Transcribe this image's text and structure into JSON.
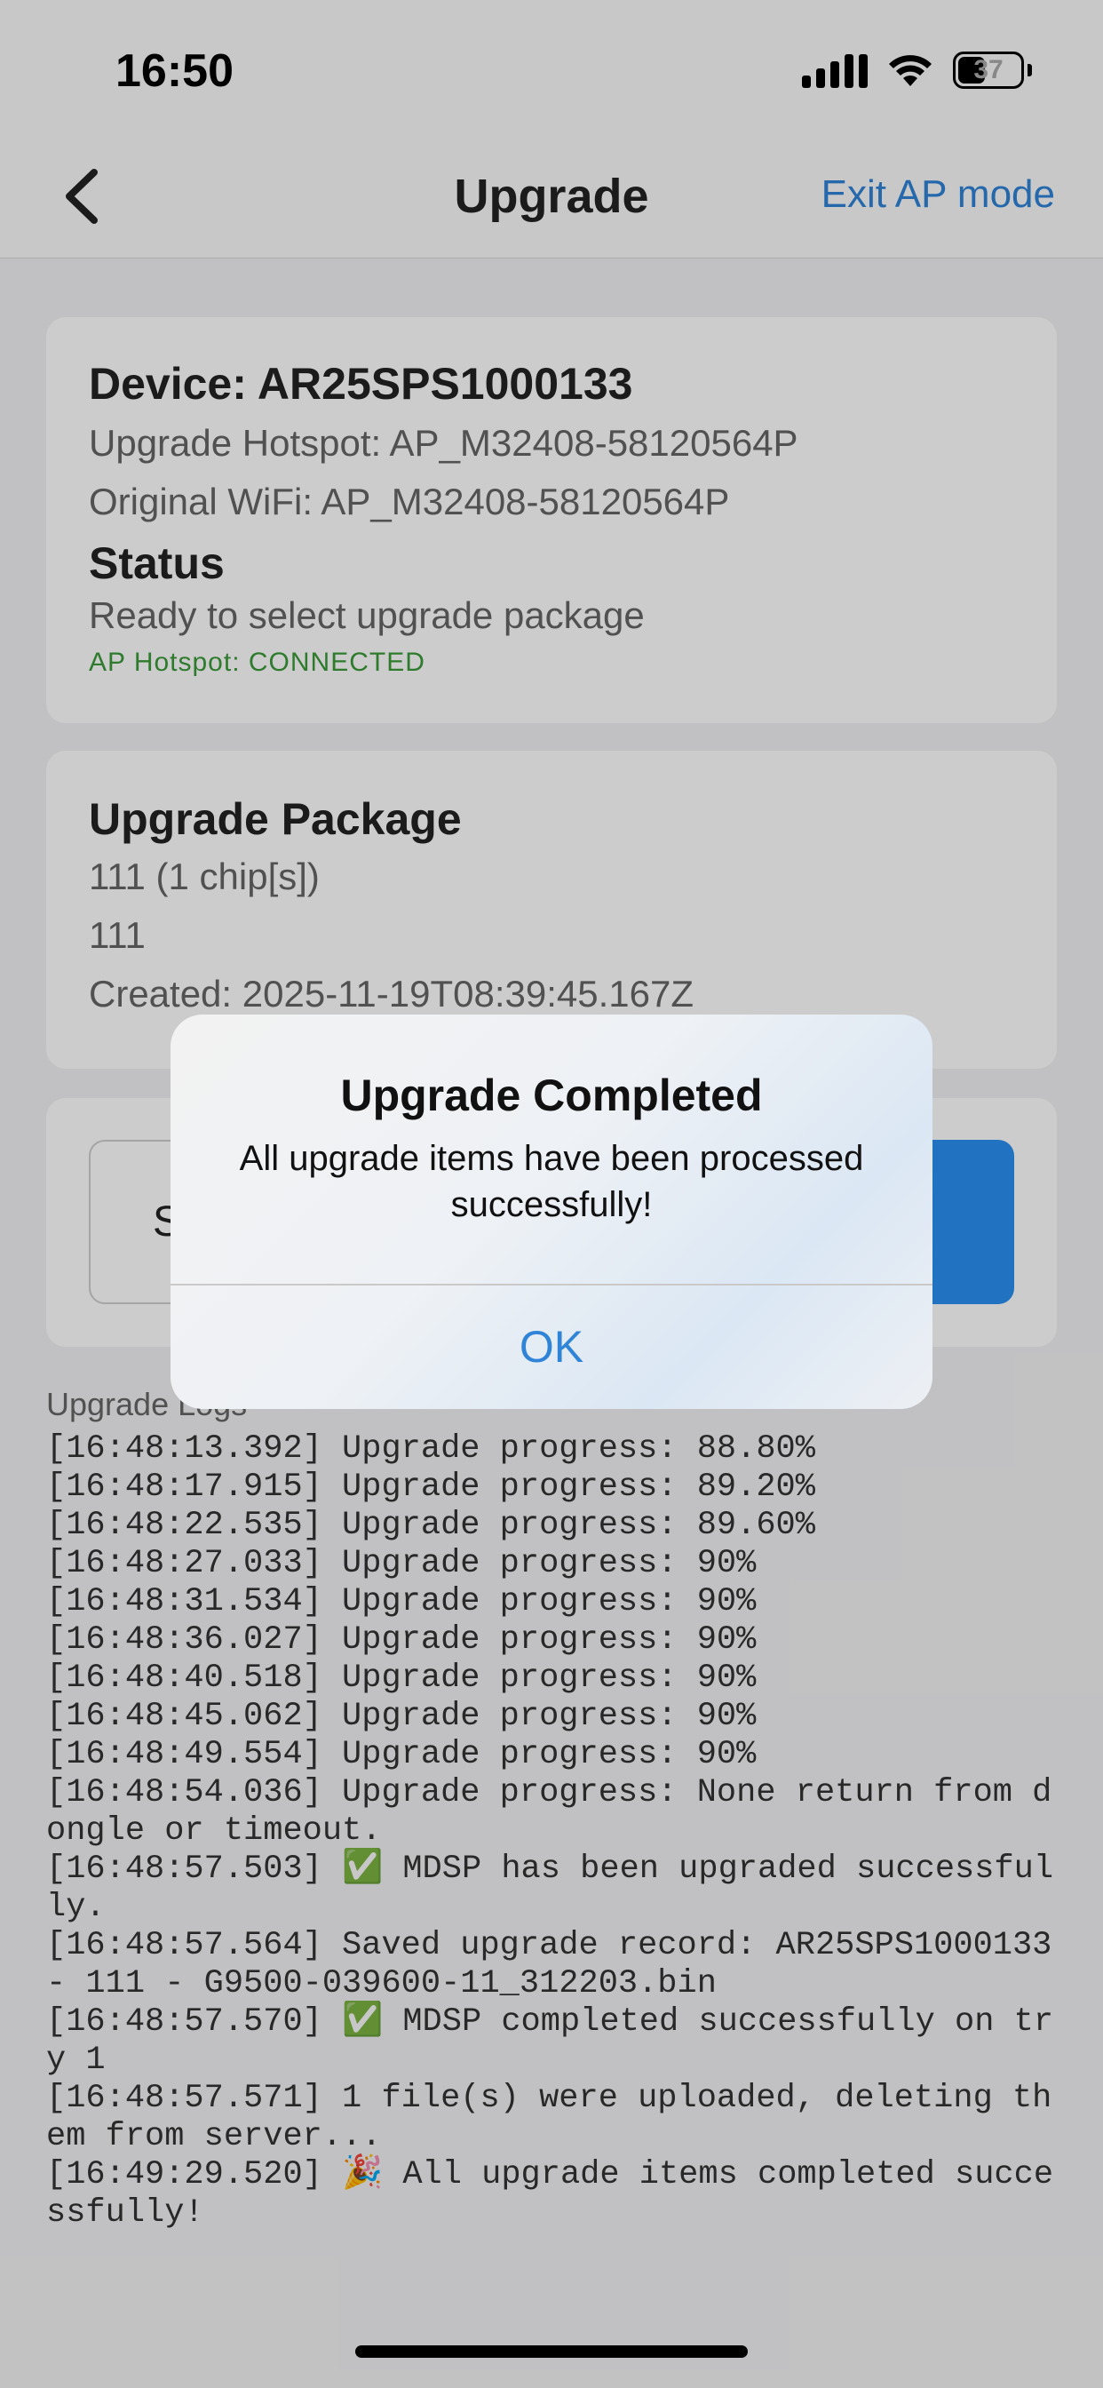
{
  "status_bar": {
    "time": "16:50",
    "battery_level": "37",
    "icons": [
      "signal-icon",
      "wifi-icon",
      "battery-icon"
    ]
  },
  "nav": {
    "title": "Upgrade",
    "back_icon": "chevron-left-icon",
    "exit_label": "Exit AP mode"
  },
  "device": {
    "title": "Device: AR25SPS1000133",
    "hotspot": "Upgrade Hotspot: AP_M32408-58120564P",
    "original_wifi": "Original WiFi: AP_M32408-58120564P",
    "status_heading": "Status",
    "status_text": "Ready to select upgrade package",
    "hotspot_status": "AP Hotspot: CONNECTED"
  },
  "package": {
    "heading": "Upgrade Package",
    "name": "111 (1 chip[s])",
    "version": "111",
    "created": "Created: 2025-11-19T08:39:45.167Z"
  },
  "actions": {
    "left_label_partial": "S"
  },
  "logs": {
    "label": "Upgrade Logs",
    "lines": [
      "[16:48:13.392] Upgrade progress: 88.80%",
      "[16:48:17.915] Upgrade progress: 89.20%",
      "[16:48:22.535] Upgrade progress: 89.60%",
      "[16:48:27.033] Upgrade progress: 90%",
      "[16:48:31.534] Upgrade progress: 90%",
      "[16:48:36.027] Upgrade progress: 90%",
      "[16:48:40.518] Upgrade progress: 90%",
      "[16:48:45.062] Upgrade progress: 90%",
      "[16:48:49.554] Upgrade progress: 90%",
      "[16:48:54.036] Upgrade progress: None return from dongle or timeout.",
      "[16:48:57.503] ✅ MDSP has been upgraded successfully.",
      "[16:48:57.564] Saved upgrade record: AR25SPS1000133 - 111 - G9500-039600-11_312203.bin",
      "[16:48:57.570] ✅ MDSP completed successfully on try 1",
      "[16:48:57.571] 1 file(s) were uploaded, deleting them from server...",
      "[16:49:29.520] 🎉 All upgrade items completed successfully!"
    ]
  },
  "dialog": {
    "title": "Upgrade Completed",
    "message": "All upgrade items have been processed successfully!",
    "ok_label": "OK"
  },
  "colors": {
    "accent": "#2f84d8",
    "success": "#3a9a3a",
    "primary_button": "#2a8ff0"
  }
}
